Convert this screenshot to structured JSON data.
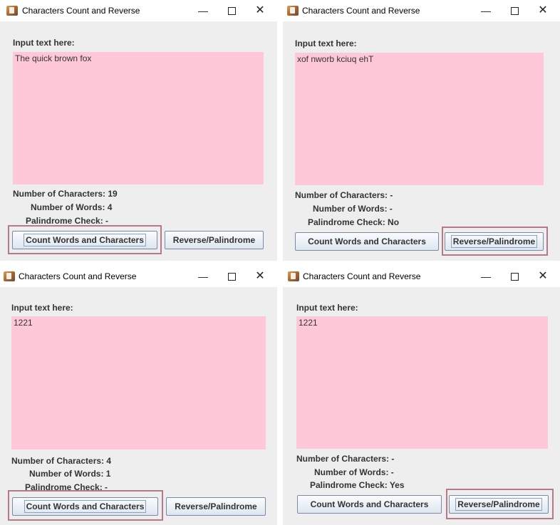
{
  "windows": [
    {
      "title": "Characters Count and Reverse",
      "input_label": "Input text here:",
      "text": "The quick brown fox",
      "chars_label": "Number of Characters: 19",
      "words_label": "Number of Words: 4",
      "palindrome_label": "Palindrome Check: -",
      "count_button": "Count Words and Characters",
      "reverse_button": "Reverse/Palindrome",
      "highlighted_button": "count"
    },
    {
      "title": "Characters Count and Reverse",
      "input_label": "Input text here:",
      "text": "xof nworb kciuq ehT",
      "chars_label": "Number of Characters: -",
      "words_label": "Number of Words: -",
      "palindrome_label": "Palindrome Check: No",
      "count_button": "Count Words and Characters",
      "reverse_button": "Reverse/Palindrome",
      "highlighted_button": "reverse"
    },
    {
      "title": "Characters Count and Reverse",
      "input_label": "Input text here:",
      "text": "1221",
      "chars_label": "Number of Characters: 4",
      "words_label": "Number of Words: 1",
      "palindrome_label": "Palindrome Check: -",
      "count_button": "Count Words and Characters",
      "reverse_button": "Reverse/Palindrome",
      "highlighted_button": "count"
    },
    {
      "title": "Characters Count and Reverse",
      "input_label": "Input text here:",
      "text": "1221",
      "chars_label": "Number of Characters: -",
      "words_label": "Number of Words: -",
      "palindrome_label": "Palindrome Check: Yes",
      "count_button": "Count Words and Characters",
      "reverse_button": "Reverse/Palindrome",
      "highlighted_button": "reverse"
    }
  ],
  "title_controls": {
    "minimize": "—",
    "close": "✕"
  },
  "colors": {
    "textarea": "#ffc8d9",
    "panel": "#eeeeee",
    "highlight": "#b47a8c"
  }
}
